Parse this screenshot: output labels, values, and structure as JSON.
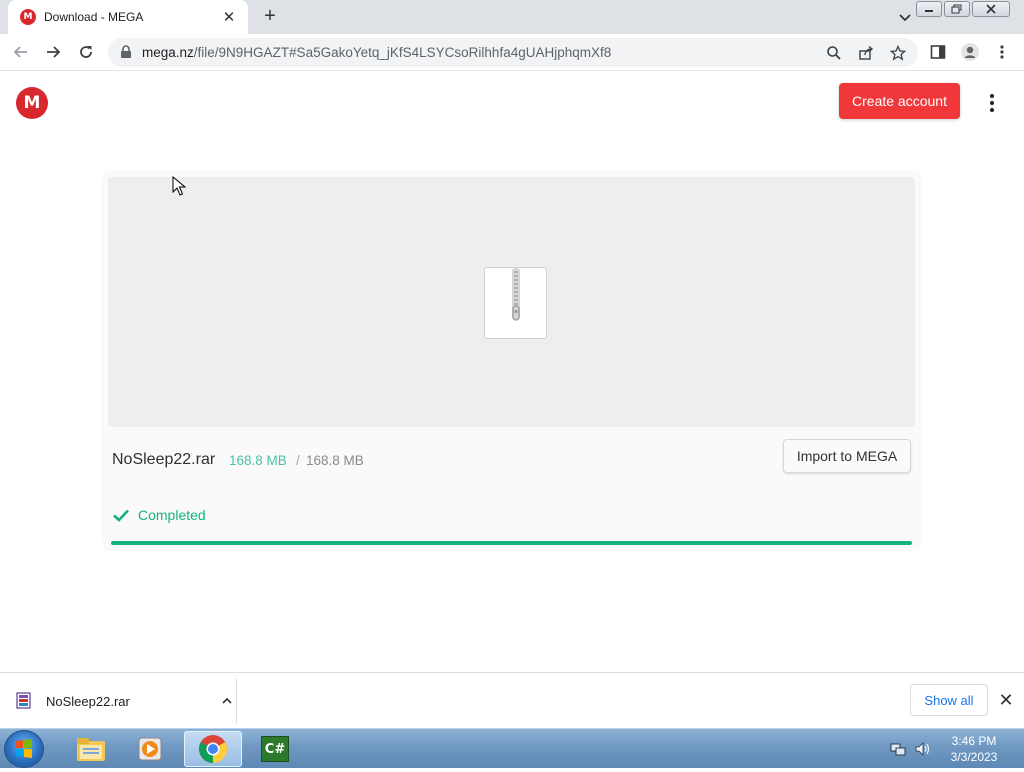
{
  "browser": {
    "tab_title": "Download - MEGA",
    "tab_favicon": "M",
    "url_host": "mega.nz",
    "url_path": "/file/9N9HGAZT#Sa5GakoYetq_jKfS4LSYCsoRilhhfa4gUAHjphqmXf8"
  },
  "page": {
    "logo_letter": "M",
    "create_account_label": "Create account",
    "file_name": "NoSleep22.rar",
    "size_downloaded": "168.8 MB",
    "size_separator": "/",
    "size_total": "168.8 MB",
    "import_label": "Import to MEGA",
    "status_label": "Completed",
    "progress_percent": 100,
    "accent_color": "#f0373a",
    "success_color": "#16b27c"
  },
  "downloads_bar": {
    "item_name": "NoSleep22.rar",
    "show_all_label": "Show all"
  },
  "taskbar": {
    "clock_time": "3:46 PM",
    "clock_date": "3/3/2023",
    "csharp_label": "C#"
  }
}
